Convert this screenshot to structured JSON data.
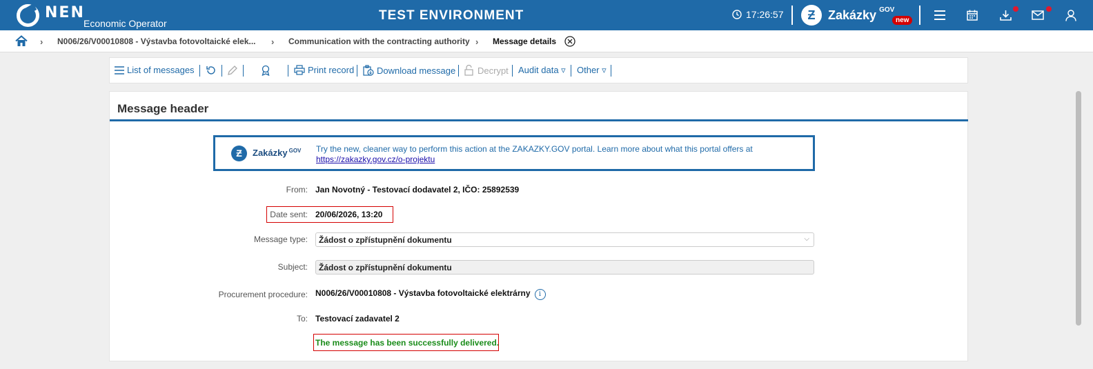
{
  "header": {
    "logo": "NEN",
    "logo_subtitle": "Economic Operator",
    "environment": "TEST ENVIRONMENT",
    "time": "17:26:57",
    "zakazky": {
      "name": "Zakázky",
      "gov": "GOV",
      "badge": "new"
    },
    "icons": [
      "menu-icon",
      "calendar-icon",
      "download-icon",
      "mail-icon",
      "user-icon"
    ]
  },
  "breadcrumb": {
    "items": [
      "N006/26/V00010808 - Výstavba fotovoltaické elek...",
      "Communication with the contracting authority",
      "Message details"
    ]
  },
  "toolbar": {
    "list_of_messages": "List of messages",
    "print_record": "Print record",
    "download_message": "Download message",
    "decrypt": "Decrypt",
    "audit_data": "Audit data ▿",
    "other": "Other ▿"
  },
  "panel": {
    "title": "Message header",
    "banner": {
      "name": "Zakázky",
      "gov": "GOV",
      "text": "Try the new, cleaner way to perform this action at the ZAKAZKY.GOV portal. Learn more about what this portal offers at",
      "link": "https://zakazky.gov.cz/o-projektu"
    },
    "fields": {
      "from_label": "From:",
      "from_value": "Jan Novotný - Testovací dodavatel 2, IČO: 25892539",
      "date_label": "Date sent:",
      "date_value": "20/06/2026, 13:20",
      "type_label": "Message type:",
      "type_value": "Žádost o zpřístupnění dokumentu",
      "subject_label": "Subject:",
      "subject_value": "Žádost o zpřístupnění dokumentu",
      "procedure_label": "Procurement procedure:",
      "procedure_value": "N006/26/V00010808 - Výstavba fotovoltaické elektrárny",
      "to_label": "To:",
      "to_value": "Testovací zadavatel 2",
      "status": "The message has been successfully delivered."
    }
  },
  "colors": {
    "brand": "#1f6aa8",
    "highlight": "#d40000",
    "success": "#1a8c1a"
  }
}
